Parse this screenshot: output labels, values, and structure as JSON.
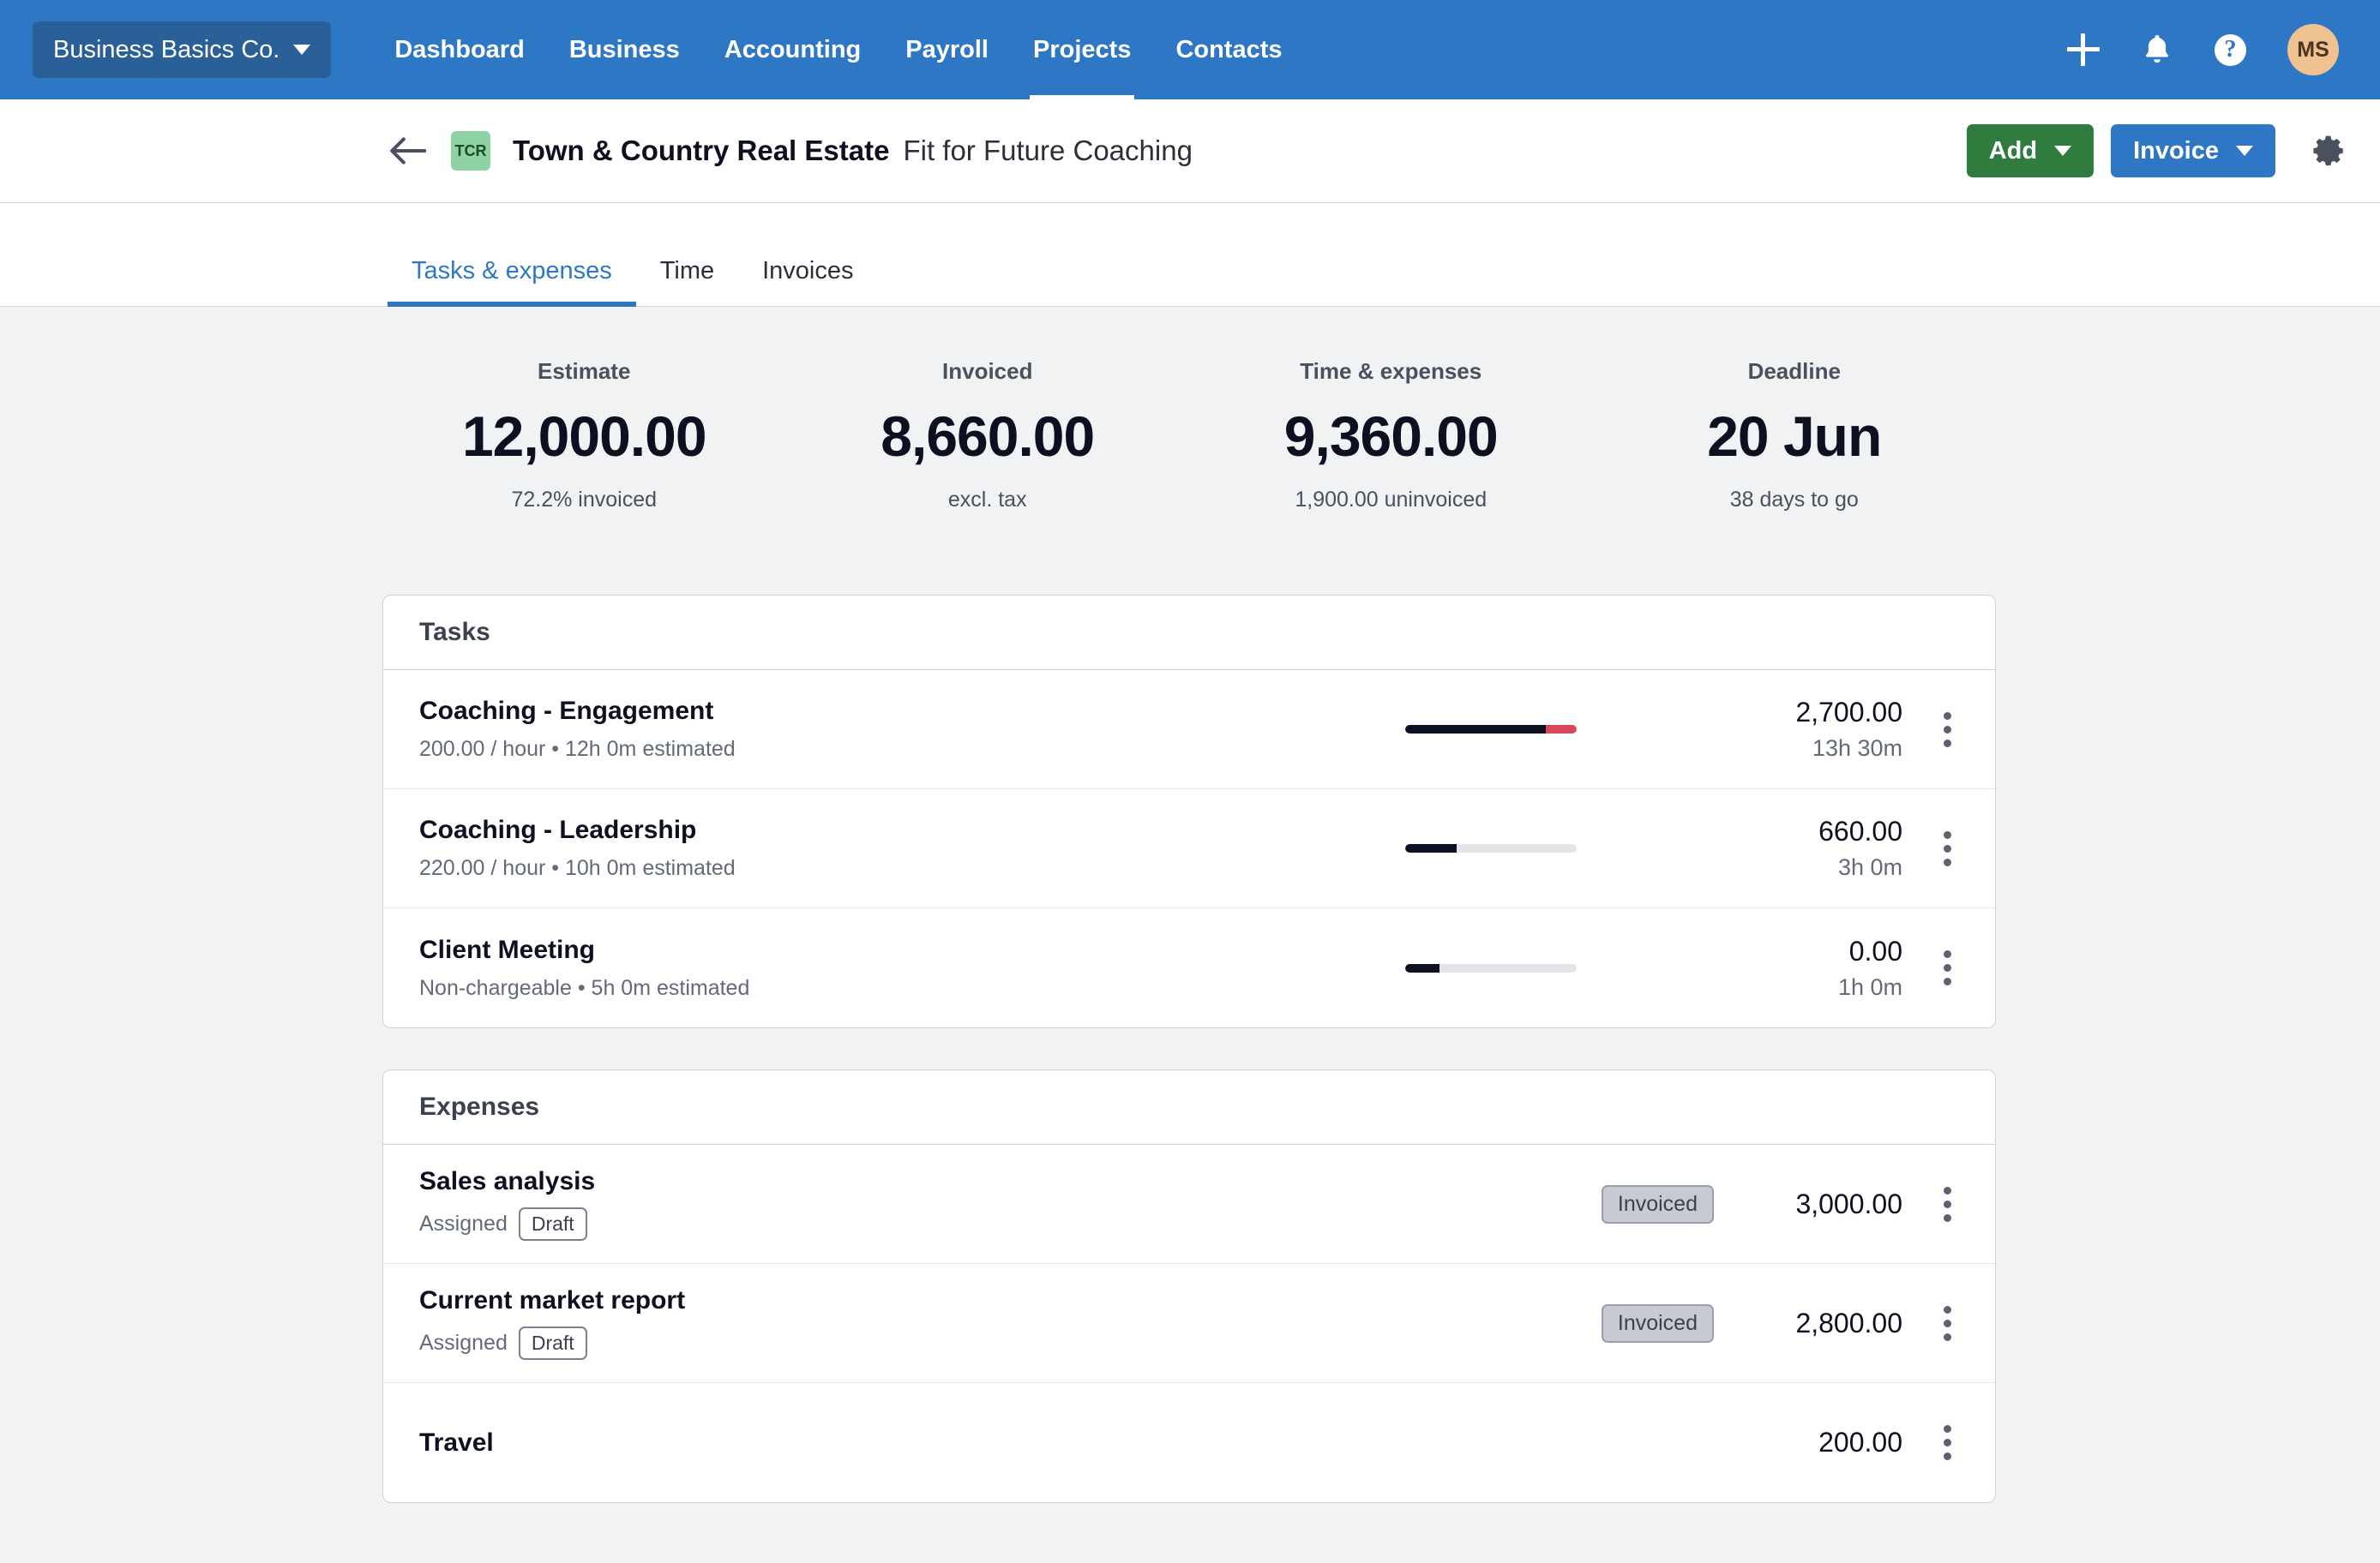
{
  "topnav": {
    "org_selector": {
      "label": "Business Basics Co.",
      "icon": "chevron-down-icon"
    },
    "links": [
      {
        "label": "Dashboard",
        "active": false
      },
      {
        "label": "Business",
        "active": false
      },
      {
        "label": "Accounting",
        "active": false
      },
      {
        "label": "Payroll",
        "active": false
      },
      {
        "label": "Projects",
        "active": true
      },
      {
        "label": "Contacts",
        "active": false
      }
    ],
    "actions": {
      "add_icon": "plus-icon",
      "notifications_icon": "bell-icon",
      "help_icon": "question-circle-icon",
      "help_glyph": "?",
      "avatar_initials": "MS"
    },
    "colors": {
      "bar": "#2e77c4",
      "org_button": "#2a6097",
      "avatar": "#f0c191"
    }
  },
  "page_header": {
    "back_icon": "arrow-left-icon",
    "client_badge": "TCR",
    "client_name": "Town & Country Real Estate",
    "project_name": "Fit for Future Coaching",
    "add_button": "Add",
    "invoice_button": "Invoice",
    "settings_icon": "gear-icon",
    "colors": {
      "add": "#2f7d3e",
      "invoice": "#2e77c4",
      "badge_bg": "#8fd3a5"
    }
  },
  "tabs": [
    {
      "label": "Tasks & expenses",
      "active": true
    },
    {
      "label": "Time",
      "active": false
    },
    {
      "label": "Invoices",
      "active": false
    }
  ],
  "summary": [
    {
      "label": "Estimate",
      "value": "12,000.00",
      "sub": "72.2% invoiced"
    },
    {
      "label": "Invoiced",
      "value": "8,660.00",
      "sub": "excl. tax"
    },
    {
      "label": "Time & expenses",
      "value": "9,360.00",
      "sub": "1,900.00 uninvoiced"
    },
    {
      "label": "Deadline",
      "value": "20 Jun",
      "sub": "38 days to go"
    }
  ],
  "tasks_card": {
    "title": "Tasks",
    "rows": [
      {
        "title": "Coaching - Engagement",
        "sub": "200.00 / hour • 12h 0m estimated",
        "progress_pct": 82,
        "overflow_pct": 18,
        "amount": "2,700.00",
        "amount_sub": "13h 30m",
        "menu_icon": "kebab-menu-icon"
      },
      {
        "title": "Coaching - Leadership",
        "sub": "220.00 / hour • 10h 0m estimated",
        "progress_pct": 30,
        "overflow_pct": 0,
        "amount": "660.00",
        "amount_sub": "3h 0m",
        "menu_icon": "kebab-menu-icon"
      },
      {
        "title": "Client Meeting",
        "sub": "Non-chargeable • 5h 0m estimated",
        "progress_pct": 20,
        "overflow_pct": 0,
        "amount": "0.00",
        "amount_sub": "1h 0m",
        "menu_icon": "kebab-menu-icon"
      }
    ]
  },
  "expenses_card": {
    "title": "Expenses",
    "rows": [
      {
        "title": "Sales analysis",
        "assigned_label": "Assigned",
        "draft_badge": "Draft",
        "status_badge": "Invoiced",
        "amount": "3,000.00",
        "menu_icon": "kebab-menu-icon"
      },
      {
        "title": "Current market report",
        "assigned_label": "Assigned",
        "draft_badge": "Draft",
        "status_badge": "Invoiced",
        "amount": "2,800.00",
        "menu_icon": "kebab-menu-icon"
      },
      {
        "title": "Travel",
        "assigned_label": "",
        "draft_badge": "",
        "status_badge": "",
        "amount": "200.00",
        "menu_icon": "kebab-menu-icon"
      }
    ]
  }
}
